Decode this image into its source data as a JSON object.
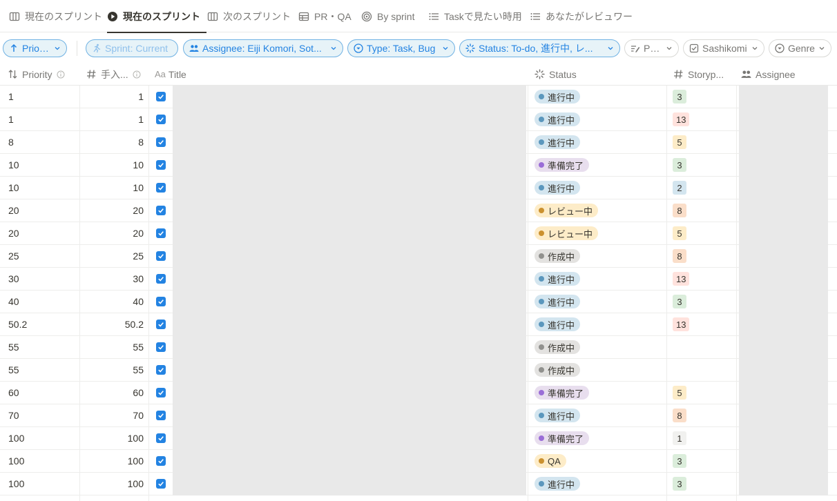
{
  "colors": {
    "accent": "#2383e2",
    "status": {
      "in_progress": {
        "bg": "#d3e5ef",
        "dot": "#5b97bd"
      },
      "ready": {
        "bg": "#e8deee",
        "dot": "#9a6dd7"
      },
      "review": {
        "bg": "#fdecc8",
        "dot": "#cb912f"
      },
      "drafting": {
        "bg": "#e3e2e0",
        "dot": "#91918e"
      },
      "qa": {
        "bg": "#fdecc8",
        "dot": "#cb912f"
      }
    },
    "story": {
      "green": "#dbeddb",
      "red": "#ffe2dd",
      "yellow": "#fdecc8",
      "blue": "#d3e5ef",
      "orange": "#fadec9",
      "grey": "#f1f1ef"
    }
  },
  "tabs": [
    {
      "label": "現在のスプリント",
      "icon": "board-icon",
      "active": false
    },
    {
      "label": "現在のスプリント",
      "icon": "play-circle-icon",
      "active": true
    },
    {
      "label": "次のスプリント",
      "icon": "board-icon",
      "active": false
    },
    {
      "label": "PR・QA",
      "icon": "table-icon",
      "active": false
    },
    {
      "label": "By sprint",
      "icon": "target-icon",
      "active": false
    },
    {
      "label": "Taskで見たい時用",
      "icon": "list-icon",
      "active": false
    },
    {
      "label": "あなたがレビュワー",
      "icon": "list-icon",
      "active": false
    }
  ],
  "filters": {
    "sort": "Priority",
    "sprint": "Sprint: Current",
    "assignee": "Assignee: Eiji Komori, Sot...",
    "type": "Type: Task, Bug",
    "status": "Status: To-do, 進行中, レ...",
    "prd": "PRD",
    "sashikomi": "Sashikomi",
    "genre": "Genre"
  },
  "columns": {
    "priority": "Priority",
    "manual": "手入...",
    "title_prefix": "Aa",
    "title": "Title",
    "status": "Status",
    "story": "Storyp...",
    "assignee": "Assignee"
  },
  "rows": [
    {
      "priority": "1",
      "manual": "1",
      "status": "進行中",
      "status_key": "in_progress",
      "story": "3",
      "story_color": "green"
    },
    {
      "priority": "1",
      "manual": "1",
      "status": "進行中",
      "status_key": "in_progress",
      "story": "13",
      "story_color": "red"
    },
    {
      "priority": "8",
      "manual": "8",
      "status": "進行中",
      "status_key": "in_progress",
      "story": "5",
      "story_color": "yellow"
    },
    {
      "priority": "10",
      "manual": "10",
      "status": "準備完了",
      "status_key": "ready",
      "story": "3",
      "story_color": "green"
    },
    {
      "priority": "10",
      "manual": "10",
      "status": "進行中",
      "status_key": "in_progress",
      "story": "2",
      "story_color": "blue"
    },
    {
      "priority": "20",
      "manual": "20",
      "status": "レビュー中",
      "status_key": "review",
      "story": "8",
      "story_color": "orange"
    },
    {
      "priority": "20",
      "manual": "20",
      "status": "レビュー中",
      "status_key": "review",
      "story": "5",
      "story_color": "yellow"
    },
    {
      "priority": "25",
      "manual": "25",
      "status": "作成中",
      "status_key": "drafting",
      "story": "8",
      "story_color": "orange"
    },
    {
      "priority": "30",
      "manual": "30",
      "status": "進行中",
      "status_key": "in_progress",
      "story": "13",
      "story_color": "red"
    },
    {
      "priority": "40",
      "manual": "40",
      "status": "進行中",
      "status_key": "in_progress",
      "story": "3",
      "story_color": "green"
    },
    {
      "priority": "50.2",
      "manual": "50.2",
      "status": "進行中",
      "status_key": "in_progress",
      "story": "13",
      "story_color": "red"
    },
    {
      "priority": "55",
      "manual": "55",
      "status": "作成中",
      "status_key": "drafting",
      "story": "",
      "story_color": ""
    },
    {
      "priority": "55",
      "manual": "55",
      "status": "作成中",
      "status_key": "drafting",
      "story": "",
      "story_color": ""
    },
    {
      "priority": "60",
      "manual": "60",
      "status": "準備完了",
      "status_key": "ready",
      "story": "5",
      "story_color": "yellow"
    },
    {
      "priority": "70",
      "manual": "70",
      "status": "進行中",
      "status_key": "in_progress",
      "story": "8",
      "story_color": "orange"
    },
    {
      "priority": "100",
      "manual": "100",
      "status": "準備完了",
      "status_key": "ready",
      "story": "1",
      "story_color": "grey"
    },
    {
      "priority": "100",
      "manual": "100",
      "status": "QA",
      "status_key": "qa",
      "story": "3",
      "story_color": "green"
    },
    {
      "priority": "100",
      "manual": "100",
      "status": "進行中",
      "status_key": "in_progress",
      "story": "3",
      "story_color": "green"
    }
  ]
}
